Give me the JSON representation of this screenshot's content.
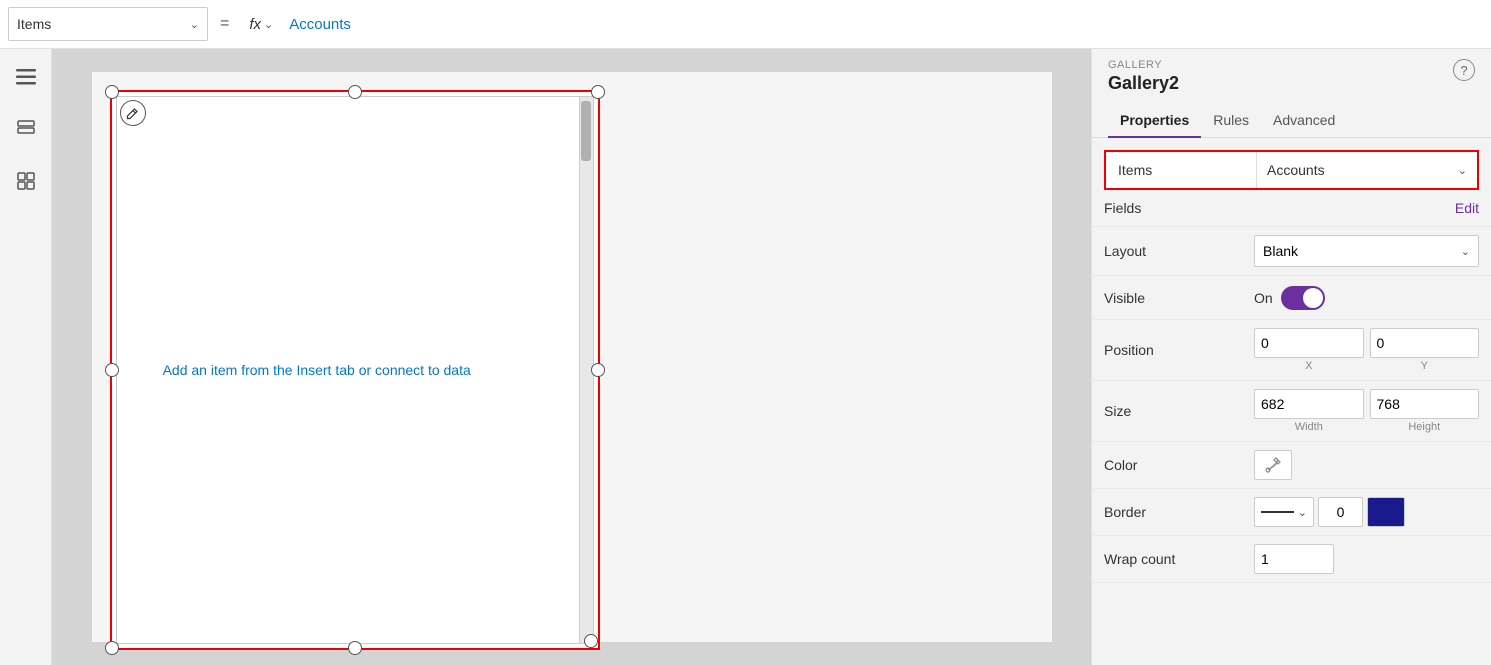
{
  "topbar": {
    "items_label": "Items",
    "equals_sign": "=",
    "fx_label": "fx",
    "accounts_label": "Accounts",
    "dropdown_chevron": "⌄"
  },
  "sidebar": {
    "icons": [
      {
        "name": "hamburger-icon",
        "symbol": "≡"
      },
      {
        "name": "layers-icon",
        "symbol": "⧉"
      },
      {
        "name": "components-icon",
        "symbol": "⊞"
      }
    ]
  },
  "canvas": {
    "gallery_empty_text": "Add an item from the Insert tab or connect to data"
  },
  "panel": {
    "section_label": "GALLERY",
    "title": "Gallery2",
    "help_label": "?",
    "tabs": [
      {
        "id": "properties",
        "label": "Properties",
        "active": true
      },
      {
        "id": "rules",
        "label": "Rules",
        "active": false
      },
      {
        "id": "advanced",
        "label": "Advanced",
        "active": false
      }
    ],
    "items_label": "Items",
    "items_value": "Accounts",
    "fields_label": "Fields",
    "fields_edit": "Edit",
    "layout_label": "Layout",
    "layout_value": "Blank",
    "visible_label": "Visible",
    "visible_on_label": "On",
    "position_label": "Position",
    "position_x": "0",
    "position_y": "0",
    "x_label": "X",
    "y_label": "Y",
    "size_label": "Size",
    "size_width": "682",
    "size_height": "768",
    "width_label": "Width",
    "height_label": "Height",
    "color_label": "Color",
    "color_icon": "↺",
    "border_label": "Border",
    "border_num": "0",
    "wrap_count_label": "Wrap count",
    "wrap_count_value": "1"
  }
}
